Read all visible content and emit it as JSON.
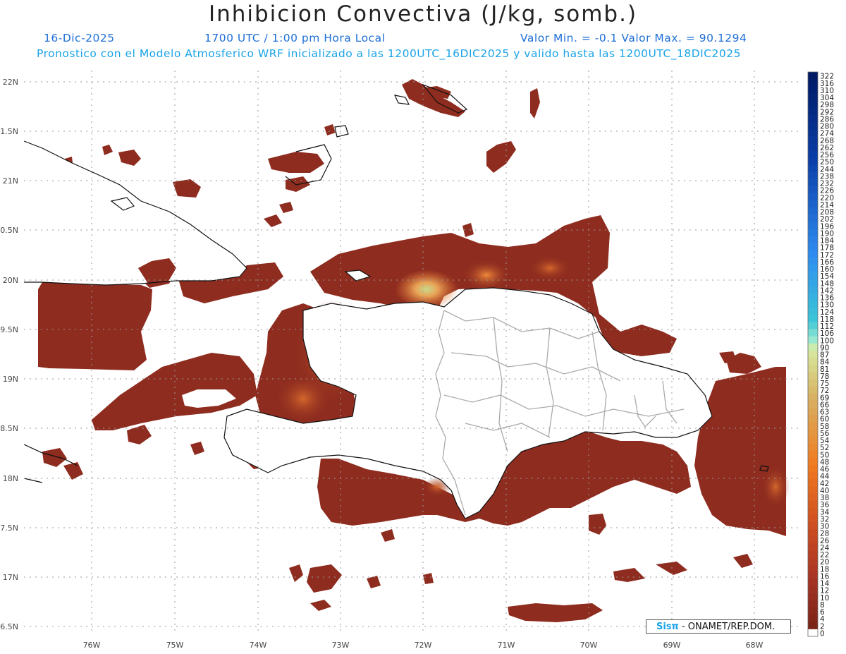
{
  "title": "Inhibicion Convectiva (J/kg, somb.)",
  "date": "16-Dic-2025",
  "time": "1700 UTC / 1:00 pm Hora Local",
  "minmax": "Valor Min. = -0.1  Valor Max. = 90.1294",
  "forecast": "Pronostico con el Modelo Atmosferico WRF inicializado a las 1200UTC_16DIC2025 y valido hasta las  1200UTC_18DIC2025",
  "credit_sis": "Sisπ",
  "credit_rest": " - ONAMET/REP.DOM.",
  "lat_labels": [
    "22N",
    "1.5N",
    "21N",
    "0.5N",
    "20N",
    "9.5N",
    "19N",
    "8.5N",
    "18N",
    "7.5N",
    "17N",
    "6.5N"
  ],
  "lon_labels": [
    "76W",
    "75W",
    "74W",
    "73W",
    "72W",
    "71W",
    "70W",
    "69W",
    "68W"
  ],
  "colorbar_labels": [
    "322",
    "316",
    "310",
    "304",
    "298",
    "292",
    "286",
    "280",
    "274",
    "268",
    "262",
    "256",
    "250",
    "244",
    "238",
    "232",
    "226",
    "220",
    "214",
    "208",
    "202",
    "196",
    "190",
    "184",
    "178",
    "172",
    "166",
    "160",
    "154",
    "148",
    "142",
    "136",
    "130",
    "124",
    "118",
    "112",
    "106",
    "100",
    "90",
    "87",
    "84",
    "81",
    "78",
    "75",
    "72",
    "69",
    "66",
    "63",
    "60",
    "58",
    "56",
    "54",
    "52",
    "50",
    "48",
    "46",
    "44",
    "42",
    "40",
    "38",
    "36",
    "34",
    "32",
    "30",
    "28",
    "26",
    "24",
    "22",
    "20",
    "18",
    "16",
    "14",
    "12",
    "10",
    "8",
    "6",
    "4",
    "2",
    "0"
  ],
  "colors": {
    "land": "#ffffff",
    "field_base": "#8e2c1f",
    "field_mid": "#b9461f",
    "field_hot": "#e0762e",
    "field_peak": "#c9d98a",
    "coast": "#111111",
    "border": "#aaaaaa"
  }
}
